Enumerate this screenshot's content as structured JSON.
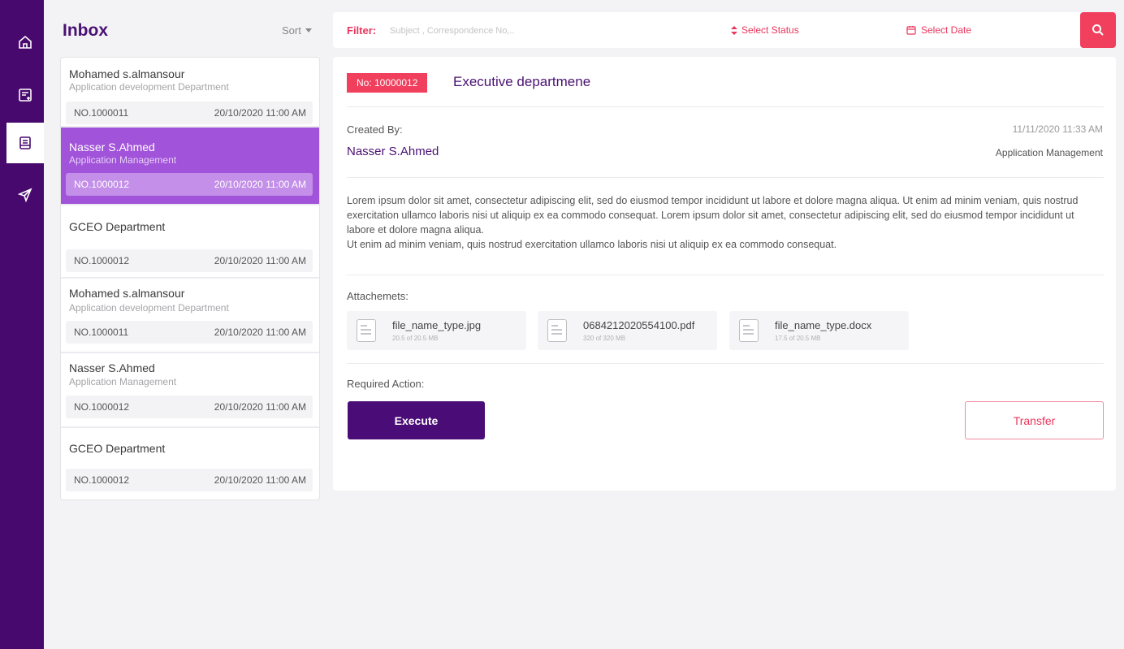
{
  "nav": {
    "items": [
      {
        "icon": "home-icon"
      },
      {
        "icon": "new-document-icon"
      },
      {
        "icon": "inbox-icon"
      },
      {
        "icon": "send-icon"
      }
    ]
  },
  "inbox": {
    "title": "Inbox",
    "sort_label": "Sort",
    "items": [
      {
        "name": "Mohamed s.almansour",
        "dept": "Application development Department",
        "no": "NO.1000011",
        "date": "20/10/2020 11:00 AM"
      },
      {
        "name": "Nasser S.Ahmed",
        "dept": "Application Management",
        "no": "NO.1000012",
        "date": "20/10/2020 11:00 AM",
        "selected": true
      },
      {
        "name": "GCEO Department",
        "dept": "",
        "no": "NO.1000012",
        "date": "20/10/2020 11:00 AM"
      },
      {
        "name": "Mohamed s.almansour",
        "dept": "Application development Department",
        "no": "NO.1000011",
        "date": "20/10/2020 11:00 AM"
      },
      {
        "name": "Nasser S.Ahmed",
        "dept": "Application Management",
        "no": "NO.1000012",
        "date": "20/10/2020 11:00 AM"
      },
      {
        "name": "GCEO Department",
        "dept": "",
        "no": "NO.1000012",
        "date": "20/10/2020 11:00 AM"
      }
    ]
  },
  "filter": {
    "label": "Filter:",
    "placeholder": "Subject , Correspondence No,..",
    "status_label": "Select Status",
    "date_label": "Select Date"
  },
  "detail": {
    "number": "No: 10000012",
    "title": "Executive departmene",
    "created_by_label": "Created By:",
    "created_date": "11/11/2020 11:33 AM",
    "created_by": "Nasser S.Ahmed",
    "created_dept": "Application Management",
    "body_1": "Lorem ipsum dolor sit amet, consectetur adipiscing elit, sed do eiusmod tempor incididunt ut labore et dolore magna aliqua. Ut enim ad minim veniam, quis nostrud exercitation ullamco laboris nisi ut aliquip ex ea commodo consequat. Lorem ipsum dolor sit amet, consectetur adipiscing elit, sed do eiusmod tempor incididunt ut labore et dolore magna aliqua.",
    "body_2": "Ut enim ad minim veniam, quis nostrud exercitation ullamco laboris nisi ut aliquip ex ea commodo consequat.",
    "attachments_label": "Attachemets:",
    "attachments": [
      {
        "name": "file_name_type.jpg",
        "size": "20.5 of 20.5 MB"
      },
      {
        "name": "0684212020554100.pdf",
        "size": "320 of 320 MB"
      },
      {
        "name": "file_name_type.docx",
        "size": "17.5 of 20.5 MB"
      }
    ],
    "required_action_label": "Required Action:",
    "execute_label": "Execute",
    "transfer_label": "Transfer"
  },
  "colors": {
    "primary": "#4a0c76",
    "accent": "#f0405d",
    "selected": "#a153d9"
  }
}
